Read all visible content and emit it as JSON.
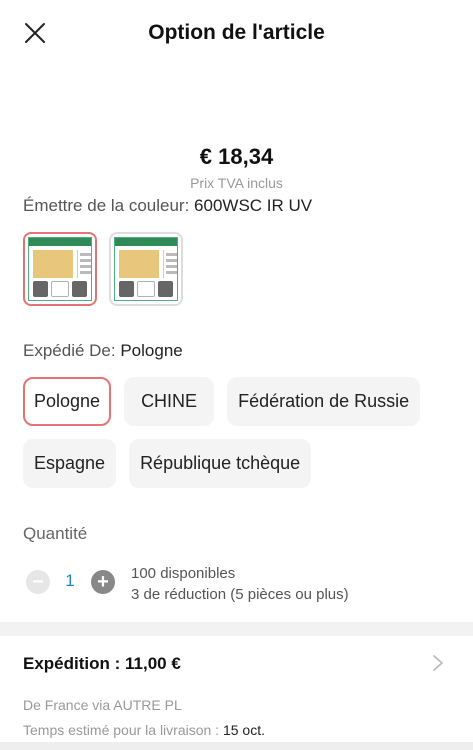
{
  "header": {
    "title": "Option de l'article",
    "close_icon": "close-icon"
  },
  "price": {
    "value": "€ 18,34",
    "vat_note": "Prix TVA inclus"
  },
  "color": {
    "label": "Émettre de la couleur: ",
    "selected": "600WSC IR UV",
    "thumbnails": [
      {
        "name": "thumb-600WSC",
        "selected": true
      },
      {
        "name": "thumb-600WSCP",
        "selected": false
      }
    ]
  },
  "ships_from": {
    "label": "Expédié De: ",
    "selected": "Pologne",
    "options": [
      "Pologne",
      "CHINE",
      "Fédération de Russie",
      "Espagne",
      "République tchèque"
    ]
  },
  "quantity": {
    "label": "Quantité",
    "value": "1",
    "minus": "−",
    "plus": "+",
    "available": "100 disponibles",
    "discount": "3 de réduction (5 pièces ou plus)"
  },
  "shipping": {
    "title": "Expédition : 11,00 €",
    "via": "De France via AUTRE PL",
    "eta_label": "Temps estimé pour la livraison : ",
    "eta_date": "15 oct."
  },
  "colors": {
    "accent": "#e57373",
    "qty_blue": "#1e88c8",
    "chip_bg": "#f4f4f4"
  }
}
